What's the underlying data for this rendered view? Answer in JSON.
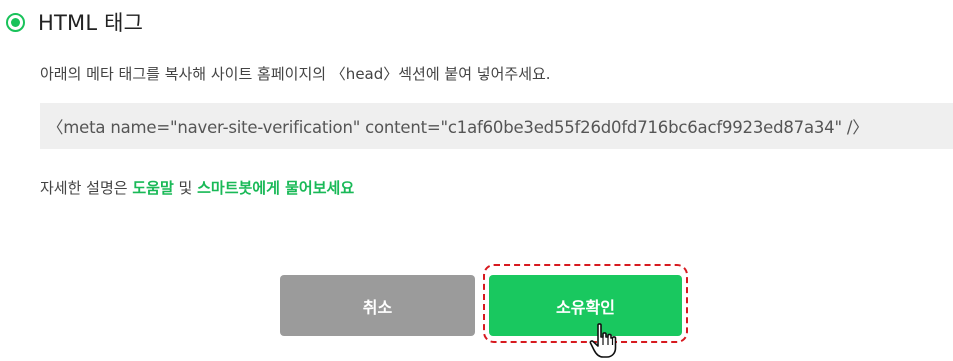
{
  "option": {
    "label": "HTML 태그",
    "selected": true,
    "accent_color": "#19c25a"
  },
  "description": "아래의 메타 태그를 복사해 사이트 홈페이지의 〈head〉섹션에 붙여 넣어주세요.",
  "meta_tag_code": "〈meta name=\"naver-site-verification\" content=\"c1af60be3ed55f26d0fd716bc6acf9923ed87a34\" /〉",
  "help": {
    "prefix": "자세한 설명은 ",
    "link_help": "도움말",
    "middle": " 및 ",
    "link_bot": "스마트봇에게 물어보세요",
    "link_color": "#19b957"
  },
  "buttons": {
    "cancel_label": "취소",
    "confirm_label": "소유확인",
    "cancel_color": "#9b9b9b",
    "confirm_color": "#19c85f"
  },
  "annotation": {
    "highlight_color": "#d7191f",
    "cursor_icon": "hand-pointer-icon"
  }
}
